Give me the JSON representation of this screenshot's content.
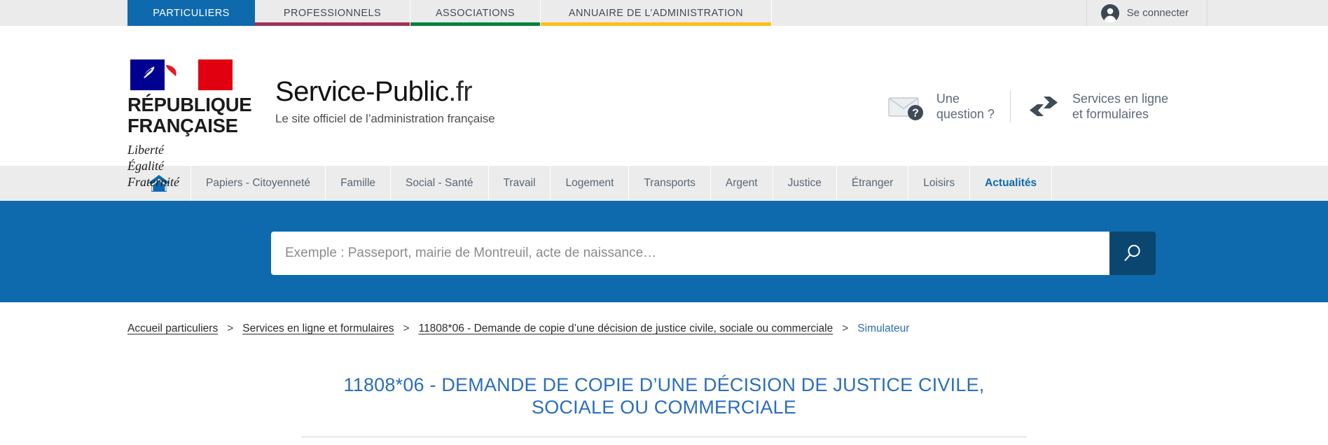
{
  "topbar": {
    "tabs": [
      {
        "label": "PARTICULIERS",
        "color": "#0e6aad",
        "active": true
      },
      {
        "label": "PROFESSIONNELS",
        "color": "#a13159",
        "active": false
      },
      {
        "label": "ASSOCIATIONS",
        "color": "#00823c",
        "active": false
      },
      {
        "label": "ANNUAIRE DE L’ADMINISTRATION",
        "color": "#f9bf1c",
        "active": false
      }
    ],
    "login_label": "Se connecter"
  },
  "brand": {
    "republic_line1": "RÉPUBLIQUE",
    "republic_line2": "FRANÇAISE",
    "devise_line1": "Liberté",
    "devise_line2": "Égalité",
    "devise_line3": "Fraternité",
    "site_name": "Service-Public",
    "site_tld": ".fr",
    "tagline": "Le site officiel de l’administration française"
  },
  "head_actions": [
    {
      "icon": "envelope-question-icon",
      "line1": "Une",
      "line2": "question ?"
    },
    {
      "icon": "exchange-arrows-icon",
      "line1": "Services en ligne",
      "line2": "et formulaires"
    }
  ],
  "nav": {
    "home_icon": "home-icon",
    "items": [
      {
        "label": "Papiers - Citoyenneté",
        "active": false
      },
      {
        "label": "Famille",
        "active": false
      },
      {
        "label": "Social - Santé",
        "active": false
      },
      {
        "label": "Travail",
        "active": false
      },
      {
        "label": "Logement",
        "active": false
      },
      {
        "label": "Transports",
        "active": false
      },
      {
        "label": "Argent",
        "active": false
      },
      {
        "label": "Justice",
        "active": false
      },
      {
        "label": "Étranger",
        "active": false
      },
      {
        "label": "Loisirs",
        "active": false
      },
      {
        "label": "Actualités",
        "active": true
      }
    ]
  },
  "search": {
    "placeholder": "Exemple : Passeport, mairie de Montreuil, acte de naissance…",
    "value": "",
    "button_icon": "search-icon"
  },
  "breadcrumb": {
    "separator": ">",
    "items": [
      {
        "label": "Accueil particuliers",
        "current": false
      },
      {
        "label": "Services en ligne et formulaires",
        "current": false
      },
      {
        "label": "11808*06 - Demande de copie d’une décision de justice civile, sociale ou commerciale",
        "current": false
      },
      {
        "label": "Simulateur",
        "current": true
      }
    ]
  },
  "main": {
    "title": "11808*06 - DEMANDE DE COPIE D’UNE DÉCISION DE JUSTICE CIVILE, SOCIALE OU COMMERCIALE"
  },
  "colors": {
    "brand_blue": "#0e6aad",
    "dark_blue": "#0b4670",
    "title_blue": "#2a6ebb",
    "bar_bg": "#ebebeb"
  }
}
